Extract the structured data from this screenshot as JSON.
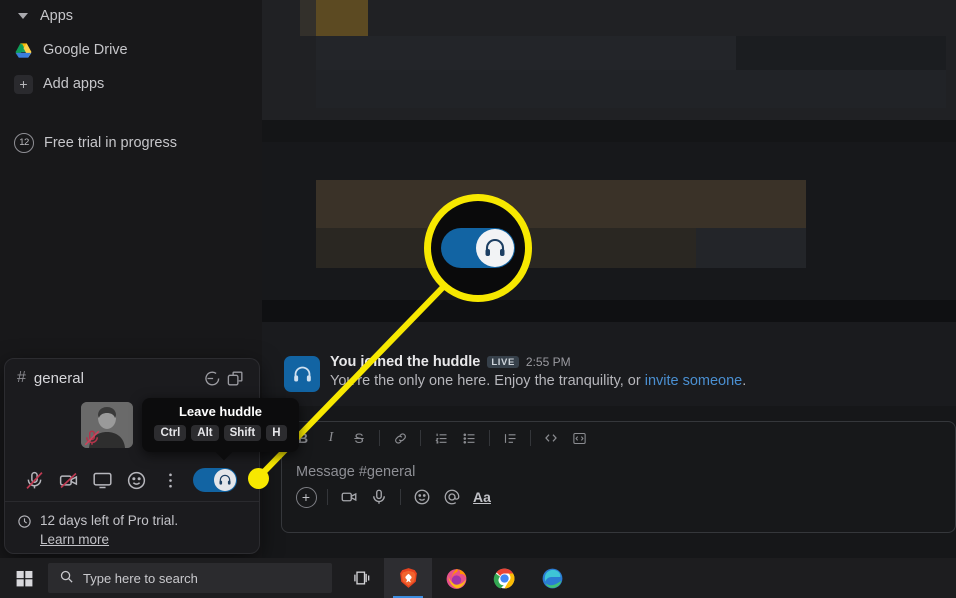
{
  "sidebar": {
    "apps_section": {
      "label": "Apps",
      "caret": "chevron-down-icon"
    },
    "items": [
      {
        "label": "Google Drive",
        "icon": "google-drive-icon"
      },
      {
        "label": "Add apps",
        "icon": "plus-icon"
      }
    ],
    "trial": {
      "label": "Free trial in progress",
      "days_badge": "12"
    }
  },
  "huddle": {
    "channel_hash": "#",
    "channel_name": "general",
    "header_icons": [
      {
        "name": "thread-chat-icon"
      },
      {
        "name": "popout-window-icon"
      }
    ],
    "participant": {
      "name": "avatar",
      "muted": true
    },
    "controls": [
      {
        "name": "mic-muted-icon"
      },
      {
        "name": "video-off-icon"
      },
      {
        "name": "screen-share-icon"
      },
      {
        "name": "reaction-emoji-icon"
      },
      {
        "name": "more-options-icon"
      }
    ],
    "leave_toggle": {
      "state": "on",
      "icon": "headphones-icon",
      "color": "#1264a3"
    },
    "trial_notice": {
      "text": "12 days left of Pro trial.",
      "link": "Learn more",
      "icon": "clock-icon"
    }
  },
  "tooltip": {
    "title": "Leave huddle",
    "keys": [
      "Ctrl",
      "Alt",
      "Shift",
      "H"
    ]
  },
  "message": {
    "avatar_icon": "headphones-icon",
    "author": "You joined the huddle",
    "badge": "LIVE",
    "time": "2:55 PM",
    "body_before": "You're the only one here. Enjoy the tranquility, or ",
    "link": "invite someone",
    "body_after": "."
  },
  "composer": {
    "placeholder": "Message #general",
    "format_buttons": [
      {
        "name": "bold-icon",
        "glyph": "B"
      },
      {
        "name": "italic-icon",
        "glyph": "I"
      },
      {
        "name": "strikethrough-icon",
        "glyph": "S"
      },
      {
        "name": "link-icon",
        "glyph": "⚭"
      },
      {
        "name": "ordered-list-icon",
        "glyph": "≡"
      },
      {
        "name": "bulleted-list-icon",
        "glyph": "≡"
      },
      {
        "name": "blockquote-icon",
        "glyph": "≡"
      },
      {
        "name": "code-icon",
        "glyph": "</>"
      },
      {
        "name": "code-block-icon",
        "glyph": "⌨"
      }
    ],
    "action_buttons": [
      {
        "name": "attach-plus-icon",
        "glyph": "+"
      },
      {
        "name": "video-clip-icon",
        "glyph": "▭"
      },
      {
        "name": "audio-clip-icon",
        "glyph": "Ⓤ"
      },
      {
        "name": "emoji-icon",
        "glyph": "☺"
      },
      {
        "name": "mention-icon",
        "glyph": "@"
      },
      {
        "name": "formatting-icon",
        "glyph": "Aa"
      }
    ]
  },
  "callout": {
    "highlight_color": "#f7e800",
    "magnified": {
      "toggle_state": "on",
      "icon": "headphones-icon",
      "color": "#1264a3"
    }
  },
  "taskbar": {
    "start": "windows-start-icon",
    "search_placeholder": "Type here to search",
    "search_icon": "search-icon",
    "taskview": "task-view-icon",
    "apps": [
      {
        "name": "brave-icon",
        "active": true
      },
      {
        "name": "firefox-icon",
        "active": false
      },
      {
        "name": "chrome-icon",
        "active": false
      },
      {
        "name": "edge-icon",
        "active": false
      }
    ]
  }
}
